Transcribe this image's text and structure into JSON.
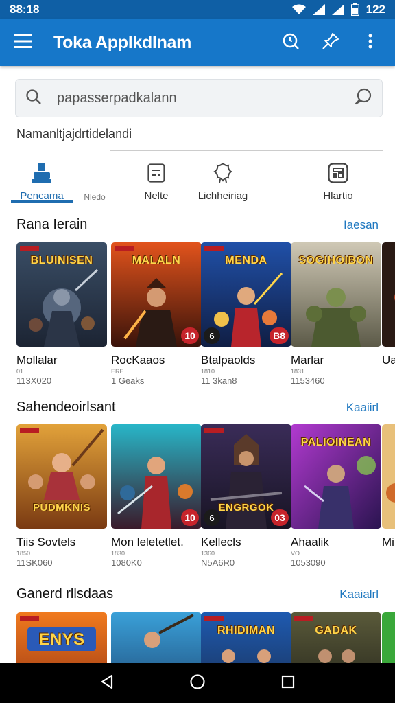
{
  "status": {
    "time": "88:18",
    "battery_text": "122"
  },
  "app_bar": {
    "title": "Toka Applkdlnam",
    "icons": [
      "menu-icon",
      "search-icon",
      "pin-icon",
      "more-vert-icon"
    ]
  },
  "search": {
    "placeholder": "papasserpadkalann"
  },
  "subtitle": "Namanltjajdrtidelandi",
  "tabs": [
    {
      "label": "Pencama",
      "icon": "home-icon",
      "active": true
    },
    {
      "label": "Nledo",
      "icon": "",
      "active": false
    },
    {
      "label": "Nelte",
      "icon": "calendar-icon",
      "active": false
    },
    {
      "label": "Lichheiriag",
      "icon": "badge-icon",
      "active": false
    },
    {
      "label": "Hlartio",
      "icon": "grid-icon",
      "active": false
    }
  ],
  "sections": [
    {
      "title": "Rana Ierain",
      "link": "Iaesan",
      "cards": [
        {
          "name": "Mollalar",
          "meta": "01",
          "count": "113X020",
          "cover_text": "BLUINISEN",
          "badge": "",
          "dark_badge": ""
        },
        {
          "name": "RocKaaos",
          "meta": "ERE",
          "count": "1 Geaks",
          "cover_text": "MALALN",
          "badge": "10",
          "dark_badge": ""
        },
        {
          "name": "Btalpaolds",
          "meta": "1810",
          "count": "11 3kan8",
          "cover_text": "MENDA",
          "badge": "B8",
          "dark_badge": "6"
        },
        {
          "name": "Marlar",
          "meta": "1831",
          "count": "1153460",
          "cover_text": "SOGIHOIBON",
          "badge": "",
          "dark_badge": ""
        },
        {
          "name": "Ua",
          "meta": "",
          "count": "",
          "cover_text": "",
          "badge": "",
          "dark_badge": ""
        }
      ]
    },
    {
      "title": "Sahendeoirlsant",
      "link": "Kaaiirl",
      "cards": [
        {
          "name": "Tiis Sovtels",
          "meta": "1850",
          "count": "11SK060",
          "cover_text": "PUDMKNIS",
          "badge": "",
          "dark_badge": ""
        },
        {
          "name": "Mon leletetlet.",
          "meta": "1830",
          "count": "1080K0",
          "cover_text": "",
          "badge": "10",
          "dark_badge": ""
        },
        {
          "name": "Kellecls",
          "meta": "1360",
          "count": "N5A6R0",
          "cover_text": "ENGRGOK",
          "badge": "03",
          "dark_badge": "6"
        },
        {
          "name": "Ahaalik",
          "meta": "VO",
          "count": "1053090",
          "cover_text": "PALIOINEAN",
          "badge": "",
          "dark_badge": ""
        },
        {
          "name": "Mi",
          "meta": "",
          "count": "",
          "cover_text": "",
          "badge": "",
          "dark_badge": ""
        }
      ]
    },
    {
      "title": "Ganerd rllsdaas",
      "link": "Kaaialrl",
      "cards": [
        {
          "name": "",
          "meta": "",
          "count": "",
          "cover_text": "ENYS",
          "badge": "",
          "dark_badge": ""
        },
        {
          "name": "",
          "meta": "",
          "count": "",
          "cover_text": "",
          "badge": "",
          "dark_badge": ""
        },
        {
          "name": "",
          "meta": "",
          "count": "",
          "cover_text": "RHIDIMAN",
          "badge": "",
          "dark_badge": ""
        },
        {
          "name": "",
          "meta": "",
          "count": "",
          "cover_text": "GADAK",
          "badge": "",
          "dark_badge": ""
        },
        {
          "name": "",
          "meta": "",
          "count": "",
          "cover_text": "",
          "badge": "",
          "dark_badge": ""
        }
      ]
    }
  ],
  "nav": [
    "back-icon",
    "home-circle-icon",
    "recents-icon"
  ]
}
